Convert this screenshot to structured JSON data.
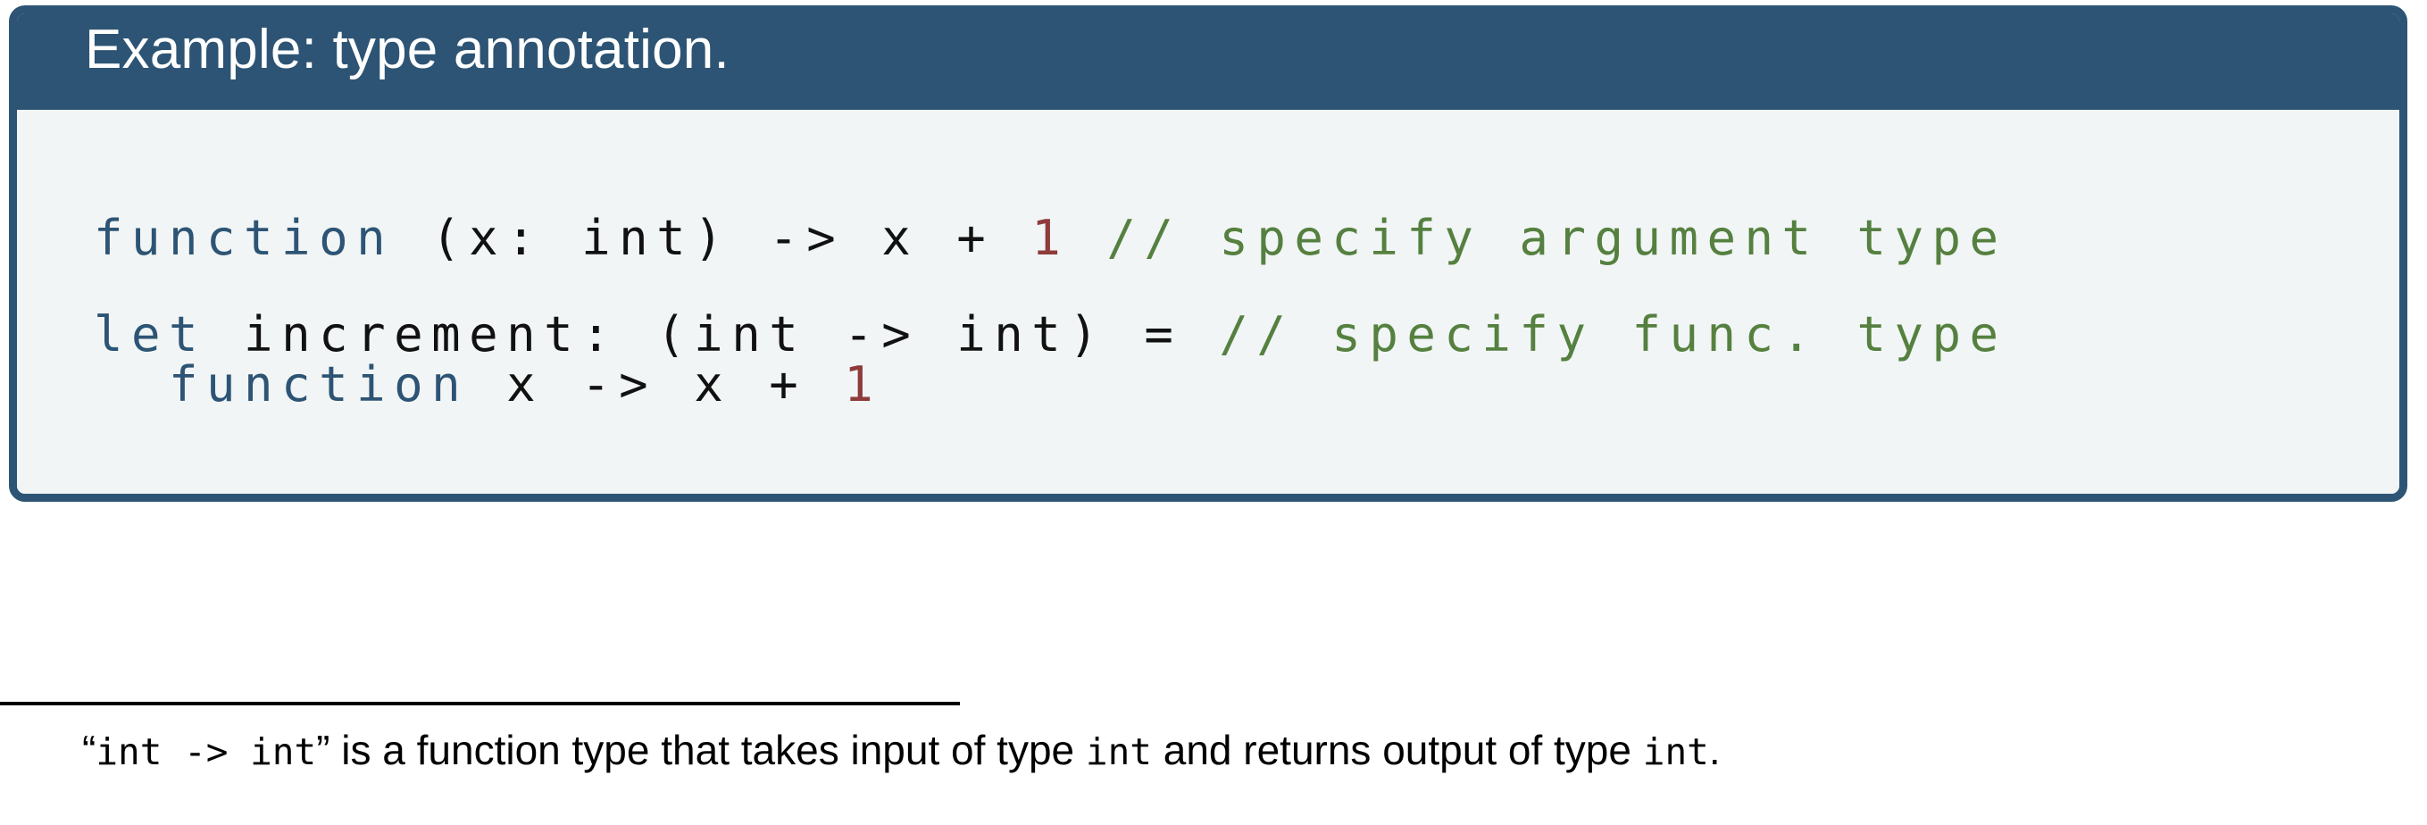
{
  "example": {
    "header_title": "Example: type annotation.",
    "header_bg": "#2d5474",
    "header_fg": "#ffffff",
    "body_bg": "#f1f5f5",
    "border_color": "#2d5474",
    "syntax_colors": {
      "keyword": "#2d5474",
      "number": "#8e3b3b",
      "comment": "#55803f",
      "plain": "#111111"
    },
    "code_lines": [
      {
        "id": "line-1",
        "tokens": [
          {
            "text": "function",
            "kind": "keyword"
          },
          {
            "text": " (x: int) -> x + ",
            "kind": "plain"
          },
          {
            "text": "1",
            "kind": "number"
          },
          {
            "text": " ",
            "kind": "plain"
          },
          {
            "text": "// specify argument type",
            "kind": "comment"
          }
        ]
      },
      {
        "id": "line-2-blank",
        "tokens": []
      },
      {
        "id": "line-3",
        "tokens": [
          {
            "text": "let",
            "kind": "keyword"
          },
          {
            "text": " increment: (int -> int) = ",
            "kind": "plain"
          },
          {
            "text": "// specify func. type",
            "kind": "comment"
          }
        ]
      },
      {
        "id": "line-4",
        "tokens": [
          {
            "text": "  ",
            "kind": "plain"
          },
          {
            "text": "function",
            "kind": "keyword"
          },
          {
            "text": " x -> x + ",
            "kind": "plain"
          },
          {
            "text": "1",
            "kind": "number"
          }
        ]
      }
    ]
  },
  "footnote": {
    "parts": [
      {
        "text": "“",
        "kind": "text"
      },
      {
        "text": "int -> int",
        "kind": "mono"
      },
      {
        "text": "” is a function type that takes input of type ",
        "kind": "text"
      },
      {
        "text": "int",
        "kind": "mono"
      },
      {
        "text": " and returns output of type ",
        "kind": "text"
      },
      {
        "text": "int",
        "kind": "mono"
      },
      {
        "text": ".",
        "kind": "text"
      }
    ],
    "rule_color": "#000000"
  }
}
